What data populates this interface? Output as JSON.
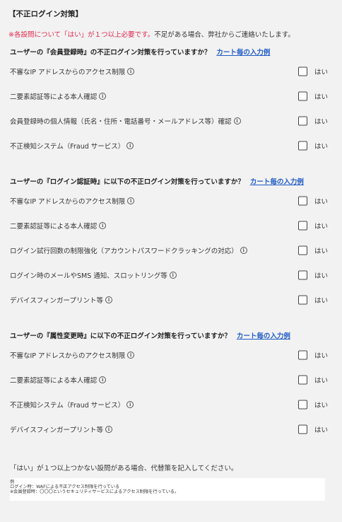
{
  "title": "【不正ログイン対策】",
  "note": {
    "red": "※各設問について「はい」が１つ以上必要です。",
    "rest": "不足がある場合、弊社からご連絡いたします。"
  },
  "sections": [
    {
      "question": "ユーザーの『会員登録時』の不正ログイン対策を行っていますか？",
      "link": "カート毎の入力例",
      "items": [
        "不審なIP アドレスからのアクセス制限",
        "二要素認証等による本人確認",
        "会員登録時の個人情報（氏名・住所・電話番号・メールアドレス等）確認",
        "不正検知システム（Fraud サービス）"
      ]
    },
    {
      "question": "ユーザーの『ログイン認証時』に以下の不正ログイン対策を行っていますか？",
      "link": "カート毎の入力例",
      "items": [
        "不審なIP アドレスからのアクセス制限",
        "二要素認証等による本人確認",
        "ログイン試行回数の制限強化（アカウントパスワードクラッキングの対応）",
        "ログイン時のメールやSMS 通知、スロットリング等",
        "デバイスフィンガープリント等"
      ]
    },
    {
      "question": "ユーザーの『属性変更時』に以下の不正ログイン対策を行っていますか？",
      "link": "カート毎の入力例",
      "items": [
        "不審なIP アドレスからのアクセス制限",
        "二要素認証等による本人確認",
        "不正検知システム（Fraud サービス）",
        "デバイスフィンガープリント等"
      ]
    }
  ],
  "yes_label": "はい",
  "info_icon": "i",
  "footer_text": "「はい」が１つ以上つかない設問がある場合、代替策を記入してください。",
  "example": {
    "heading": "例",
    "line1": "ログイン時：WAFによる不正アクセス制限を行っている",
    "line2": "※会員登録時：〇〇〇というセキュリティサービスによるアクセス制限を行っている。"
  }
}
